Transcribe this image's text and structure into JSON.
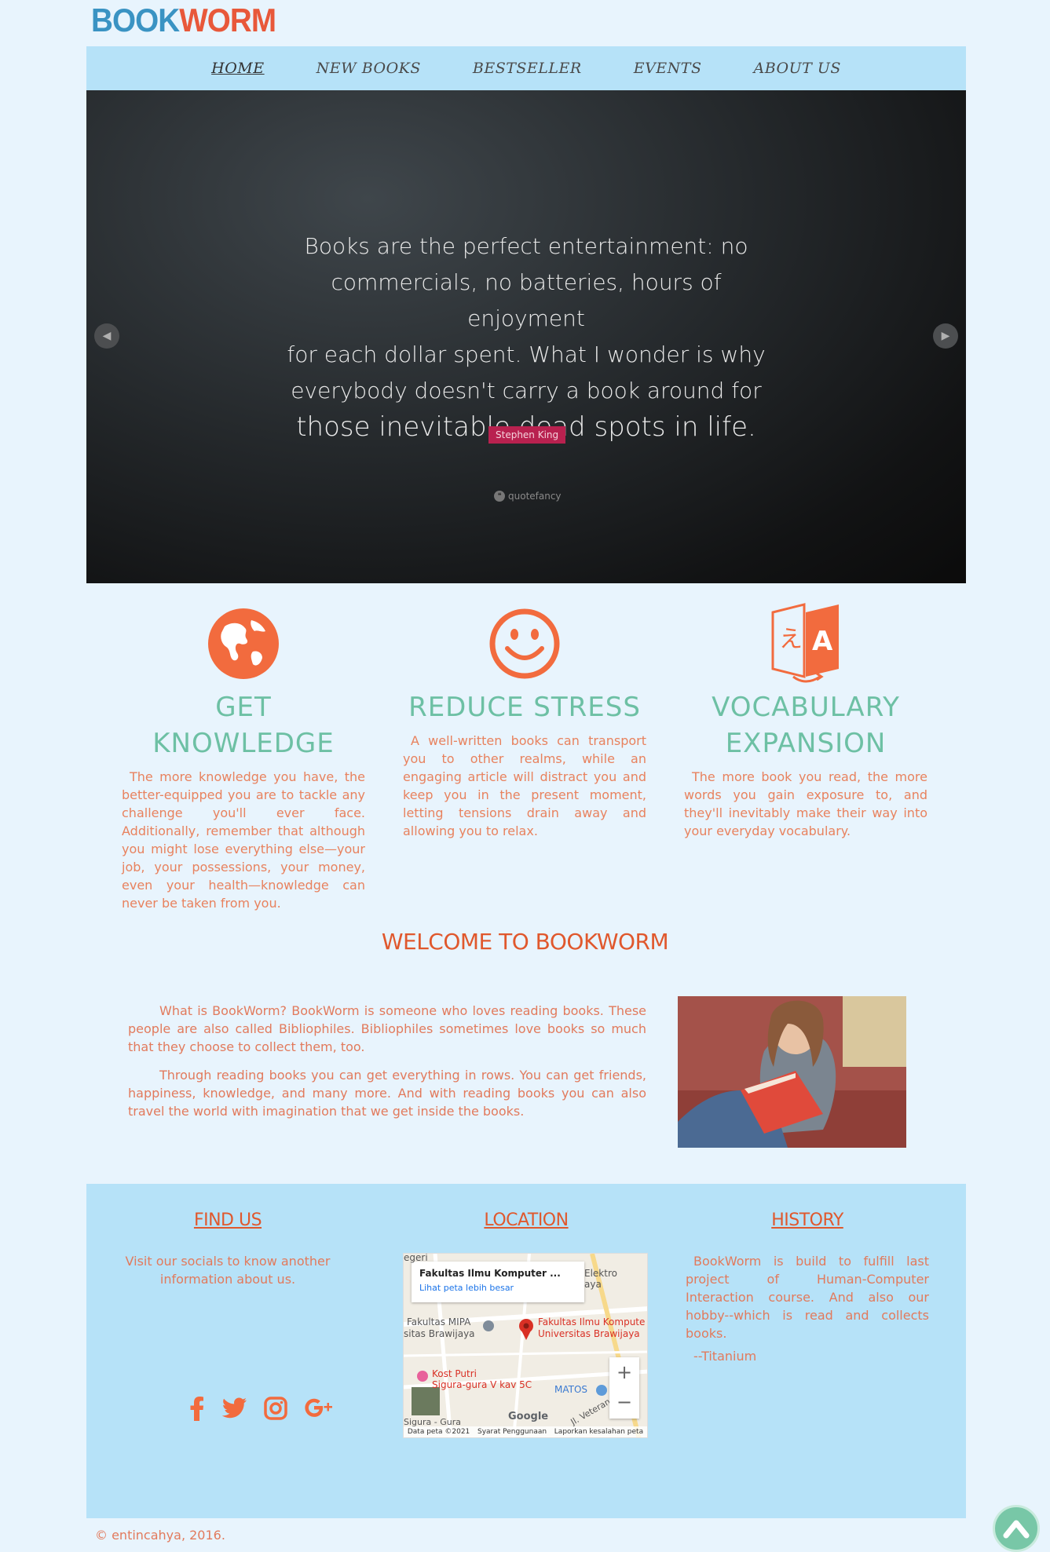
{
  "logo": {
    "part1": "BOOK",
    "part2": "WORM"
  },
  "nav": {
    "items": [
      "HOME",
      "NEW BOOKS",
      "BESTSELLER",
      "EVENTS",
      "ABOUT US"
    ],
    "active": "HOME"
  },
  "slider": {
    "quote_lines": [
      "Books are the perfect entertainment: no",
      "commercials, no batteries, hours of enjoyment",
      "for each dollar spent. What I wonder is why",
      "everybody doesn't carry a book around for",
      "those inevitable dead spots in life."
    ],
    "author": "Stephen King",
    "watermark": "quotefancy",
    "prev_icon": "chevron-left-icon",
    "next_icon": "chevron-right-icon"
  },
  "features": [
    {
      "icon": "globe-icon",
      "title": "GET KNOWLEDGE",
      "text": "The more knowledge you have, the better-equipped you are to tackle any challenge you'll ever face. Additionally, remember that although you might lose everything else—your job, your possessions, your money, even your health—knowledge can never be taken from you."
    },
    {
      "icon": "smiley-icon",
      "title": "REDUCE STRESS",
      "text": "A well-written books can transport you to other realms, while an engaging article will distract you and keep you in the present moment, letting tensions drain away and allowing you to relax."
    },
    {
      "icon": "translate-icon",
      "title": "VOCABULARY EXPANSION",
      "text": "The more book you read, the more words you gain exposure to, and they'll inevitably make their way into your everyday vocabulary."
    }
  ],
  "welcome": {
    "title": "WELCOME TO BOOKWORM",
    "paragraphs": [
      "What is BookWorm? BookWorm is someone who loves reading books. These people are also called Bibliophiles. Bibliophiles sometimes love books so much that they choose to collect them, too.",
      "Through reading books you can get everything in rows. You can get friends, happiness, knowledge, and many more. And with reading books you can also travel the world with imagination that we get inside the books."
    ]
  },
  "footer": {
    "find_us": {
      "title": "FIND US",
      "text": "Visit our socials to know another information about us.",
      "socials": [
        "facebook-icon",
        "twitter-icon",
        "instagram-icon",
        "google-plus-icon"
      ]
    },
    "location": {
      "title": "LOCATION",
      "map": {
        "card_title": "Fakultas Ilmu Komputer ...",
        "card_link": "Lihat peta lebih besar",
        "labels": [
          "egeri",
          "Elektro",
          "aya",
          "Fakultas MIPA",
          "sitas Brawijaya",
          "Fakultas Ilmu Kompute",
          "Universitas Brawijaya",
          "Kost Putri",
          "Sigura-gura V kav 5C",
          "MATOS",
          "Jl. Veteran",
          "Sigura - Gura"
        ],
        "zoom_in": "+",
        "zoom_out": "−",
        "google": "Google",
        "attribution": [
          "Data peta ©2021",
          "Syarat Penggunaan",
          "Laporkan kesalahan peta"
        ]
      }
    },
    "history": {
      "title": "HISTORY",
      "text": "BookWorm is build to fulfill last project of Human-Computer Interaction course. And also our hobby--which is read and collects books.",
      "signature": "--Titanium"
    }
  },
  "copyright": "© entincahya, 2016.",
  "back_to_top_icon": "chevron-up-icon"
}
